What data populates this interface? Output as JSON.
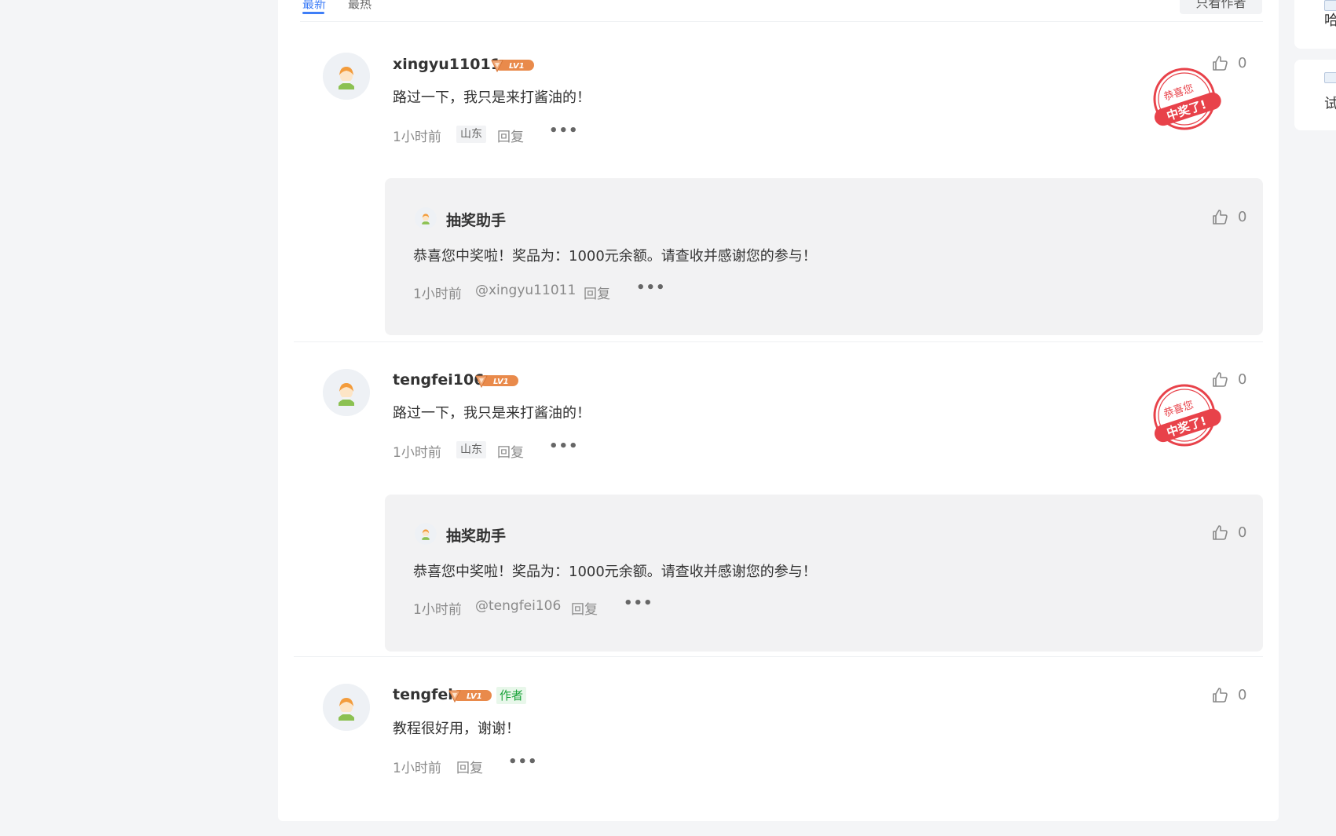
{
  "tabs": {
    "latest": "最新",
    "hottest": "最热"
  },
  "author_only_label": "只看作者",
  "side": {
    "item1_text": "哈",
    "item2_text": "试"
  },
  "stamp": {
    "line1": "恭喜您",
    "line2": "中奖了!"
  },
  "comments": [
    {
      "user": "xingyu11011",
      "level": "LV1",
      "text": "路过一下，我只是来打酱油的！",
      "time": "1小时前",
      "region": "山东",
      "reply_label": "回复",
      "likes": "0",
      "reply": {
        "user": "抽奖助手",
        "text": "恭喜您中奖啦！奖品为：1000元余额。请查收并感谢您的参与！",
        "time": "1小时前",
        "mention": "@xingyu11011",
        "reply_label": "回复",
        "likes": "0"
      }
    },
    {
      "user": "tengfei106",
      "level": "LV1",
      "text": "路过一下，我只是来打酱油的！",
      "time": "1小时前",
      "region": "山东",
      "reply_label": "回复",
      "likes": "0",
      "reply": {
        "user": "抽奖助手",
        "text": "恭喜您中奖啦！奖品为：1000元余额。请查收并感谢您的参与！",
        "time": "1小时前",
        "mention": "@tengfei106",
        "reply_label": "回复",
        "likes": "0"
      }
    },
    {
      "user": "tengfei",
      "level": "LV1",
      "author_tag": "作者",
      "text": "教程很好用，谢谢！",
      "time": "1小时前",
      "reply_label": "回复",
      "likes": "0"
    }
  ],
  "colors": {
    "accent": "#3f7ef7",
    "stamp_red": "#e8424a",
    "badge_orange": "#e98a4b",
    "author_green": "#1aa33a"
  }
}
